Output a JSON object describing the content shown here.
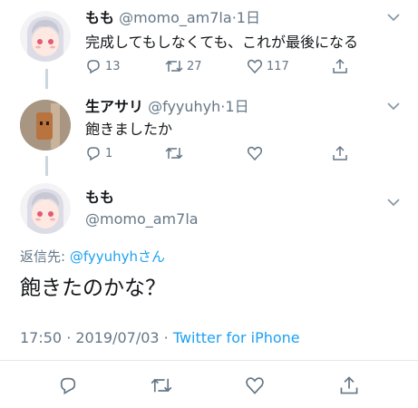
{
  "tweet1": {
    "name": "もも",
    "handle": "@momo_am7la",
    "dot": "·",
    "time": "1日",
    "text": "完成してもしなくても、これが最後になる",
    "replies": "13",
    "retweets": "27",
    "likes": "117"
  },
  "tweet2": {
    "name": "生アサリ",
    "handle": "@fyyuhyh",
    "dot": "·",
    "time": "1日",
    "text": "飽きましたか",
    "replies": "1"
  },
  "focus": {
    "name": "もも",
    "handle": "@momo_am7la",
    "replying_prefix": "返信先: ",
    "replying_to": "@fyyuhyhさん",
    "text": "飽きたのかな？",
    "timestamp": "17:50 · 2019/07/03 · ",
    "app": "Twitter for iPhone"
  },
  "colors": {
    "accent": "#1da1f2",
    "muted": "#657786",
    "line": "#ccd6dd"
  },
  "icons": [
    "reply-icon",
    "retweet-icon",
    "like-icon",
    "share-icon",
    "chevron-down-icon"
  ]
}
